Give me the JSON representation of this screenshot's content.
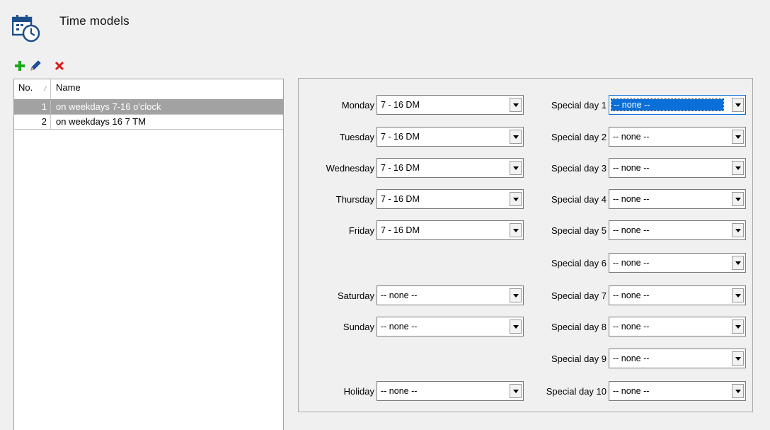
{
  "page": {
    "title": "Time models"
  },
  "icons": {
    "header": "calendar-clock-icon",
    "add": "plus-icon",
    "edit": "pencil-icon",
    "delete": "close-icon",
    "sort": "sort-icon",
    "dropdown": "chevron-down-icon"
  },
  "colors": {
    "add": "#1aa91a",
    "delete": "#d81c1c",
    "edit": "#1f4fa8",
    "selection": "#0a6fd8",
    "selected_row": "#a2a2a2"
  },
  "list": {
    "columns": {
      "no": "No.",
      "name": "Name"
    },
    "rows": [
      {
        "no": "1",
        "name": "on weekdays 7-16 o'clock",
        "selected": true
      },
      {
        "no": "2",
        "name": "on weekdays 16 7 TM",
        "selected": false
      }
    ]
  },
  "days": [
    {
      "label": "Monday",
      "value": "7 - 16 DM"
    },
    {
      "label": "Tuesday",
      "value": "7 - 16 DM"
    },
    {
      "label": "Wednesday",
      "value": "7 - 16 DM"
    },
    {
      "label": "Thursday",
      "value": "7 - 16 DM"
    },
    {
      "label": "Friday",
      "value": "7 - 16 DM"
    },
    {
      "label": "Saturday",
      "value": "-- none --"
    },
    {
      "label": "Sunday",
      "value": "-- none --"
    },
    {
      "label": "Holiday",
      "value": "-- none --"
    }
  ],
  "special_days": [
    {
      "label": "Special day 1",
      "value": "-- none --"
    },
    {
      "label": "Special day 2",
      "value": "-- none --"
    },
    {
      "label": "Special day 3",
      "value": "-- none --"
    },
    {
      "label": "Special day 4",
      "value": "-- none --"
    },
    {
      "label": "Special day 5",
      "value": "-- none --"
    },
    {
      "label": "Special day 6",
      "value": "-- none --"
    },
    {
      "label": "Special day 7",
      "value": "-- none --"
    },
    {
      "label": "Special day 8",
      "value": "-- none --"
    },
    {
      "label": "Special day 9",
      "value": "-- none --"
    },
    {
      "label": "Special day 10",
      "value": "-- none --"
    }
  ]
}
